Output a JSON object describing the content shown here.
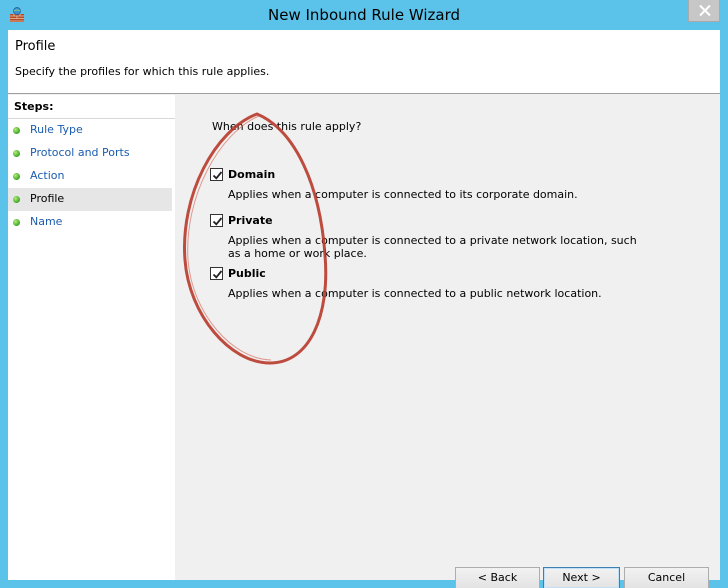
{
  "window": {
    "title": "New Inbound Rule Wizard"
  },
  "header": {
    "title": "Profile",
    "subtitle": "Specify the profiles for which this rule applies."
  },
  "steps": {
    "heading": "Steps:",
    "items": [
      {
        "label": "Rule Type",
        "active": false
      },
      {
        "label": "Protocol and Ports",
        "active": false
      },
      {
        "label": "Action",
        "active": false
      },
      {
        "label": "Profile",
        "active": true
      },
      {
        "label": "Name",
        "active": false
      }
    ]
  },
  "content": {
    "question": "When does this rule apply?",
    "options": [
      {
        "label": "Domain",
        "checked": true,
        "description": "Applies when a computer is connected to its corporate domain."
      },
      {
        "label": "Private",
        "checked": true,
        "description": "Applies when a computer is connected to a private network location, such as a home or work place."
      },
      {
        "label": "Public",
        "checked": true,
        "description": "Applies when a computer is connected to a public network location."
      }
    ]
  },
  "buttons": {
    "back": "< Back",
    "next": "Next >",
    "cancel": "Cancel"
  },
  "colors": {
    "title_bar": "#5bc3ea",
    "step_link": "#1b5cae",
    "annotation_ellipse": "#b7392a"
  }
}
